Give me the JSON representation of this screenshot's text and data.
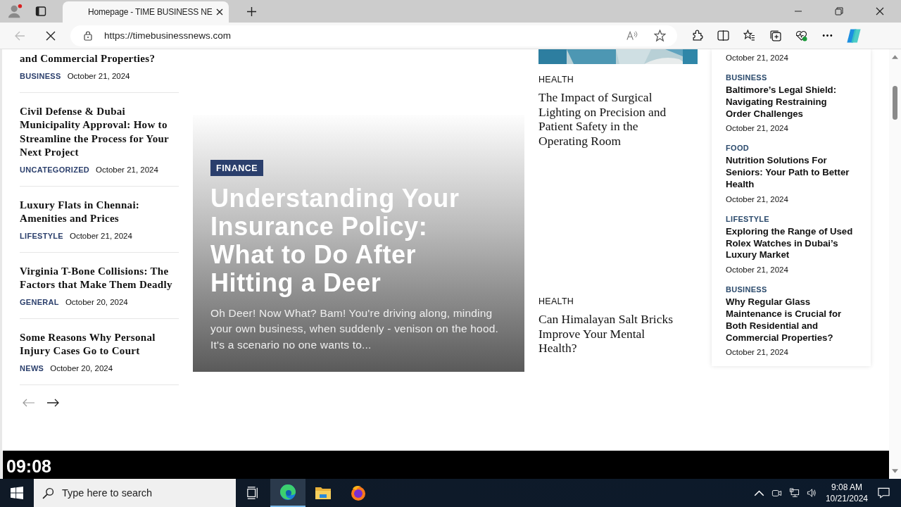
{
  "browser": {
    "tab": {
      "title": "Homepage - TIME BUSINESS NE",
      "selected": true
    },
    "url": "https://timebusinessnews.com"
  },
  "left_list": [
    {
      "title": "and Commercial Properties?",
      "category": "BUSINESS",
      "date": "October 21, 2024"
    },
    {
      "title": "Civil Defense & Dubai Municipality Approval: How to Streamline the Process for Your Next Project",
      "category": "UNCATEGORIZED",
      "date": "October 21, 2024"
    },
    {
      "title": "Luxury Flats in Chennai: Amenities and Prices",
      "category": "LIFESTYLE",
      "date": "October 21, 2024"
    },
    {
      "title": "Virginia T-Bone Collisions: The Factors that Make Them Deadly",
      "category": "GENERAL",
      "date": "October 20, 2024"
    },
    {
      "title": "Some Reasons Why Personal Injury Cases Go to Court",
      "category": "NEWS",
      "date": "October 20, 2024"
    }
  ],
  "hero": {
    "category": "FINANCE",
    "title": "Understanding Your Insurance Policy: What to Do After Hitting a Deer",
    "excerpt": "Oh Deer! Now What? Bam! You're driving along, minding your own business, when suddenly - venison on the hood. It's a scenario no one wants to..."
  },
  "middle_list": [
    {
      "category": "HEALTH",
      "title": "The Impact of Surgical Lighting on Precision and Patient Safety in the Operating Room"
    },
    {
      "category": "HEALTH",
      "title": "Can Himalayan Salt Bricks Improve Your Mental Health?"
    }
  ],
  "sidebar": [
    {
      "date": "October 21, 2024"
    },
    {
      "category": "BUSINESS",
      "title": "Baltimore’s Legal Shield: Navigating Restraining Order Challenges",
      "date": "October 21, 2024"
    },
    {
      "category": "FOOD",
      "title": "Nutrition Solutions For Seniors: Your Path to Better Health",
      "date": "October 21, 2024"
    },
    {
      "category": "LIFESTYLE",
      "title": "Exploring the Range of Used Rolex Watches in Dubai’s Luxury Market",
      "date": "October 21, 2024"
    },
    {
      "category": "BUSINESS",
      "title": "Why Regular Glass Maintenance is Crucial for Both Residential and Commercial Properties?",
      "date": "October 21, 2024"
    }
  ],
  "clock_bar": "09:08",
  "taskbar": {
    "search_placeholder": "Type here to search",
    "time": "9:08 AM",
    "date": "10/21/2024"
  }
}
